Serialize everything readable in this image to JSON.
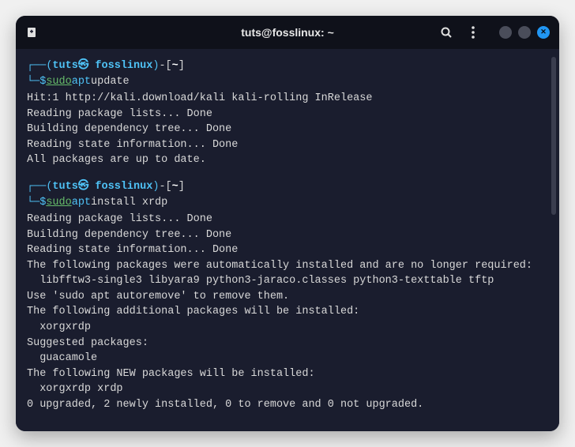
{
  "titlebar": {
    "title": "tuts@fosslinux: ~"
  },
  "prompts": [
    {
      "user_host": "tuts㉿ fosslinux",
      "path": "~",
      "sudo": "sudo",
      "apt": "apt",
      "rest": " update"
    },
    {
      "user_host": "tuts㉿ fosslinux",
      "path": "~",
      "sudo": "sudo",
      "apt": "apt",
      "rest": " install xrdp"
    }
  ],
  "output_block1": [
    "Hit:1 http://kali.download/kali kali-rolling InRelease",
    "Reading package lists... Done",
    "Building dependency tree... Done",
    "Reading state information... Done",
    "All packages are up to date."
  ],
  "output_block2": [
    "Reading package lists... Done",
    "Building dependency tree... Done",
    "Reading state information... Done",
    "The following packages were automatically installed and are no longer required:",
    "  libfftw3-single3 libyara9 python3-jaraco.classes python3-texttable tftp",
    "Use 'sudo apt autoremove' to remove them.",
    "The following additional packages will be installed:",
    "  xorgxrdp",
    "Suggested packages:",
    "  guacamole",
    "The following NEW packages will be installed:",
    "  xorgxrdp xrdp",
    "0 upgraded, 2 newly installed, 0 to remove and 0 not upgraded."
  ]
}
